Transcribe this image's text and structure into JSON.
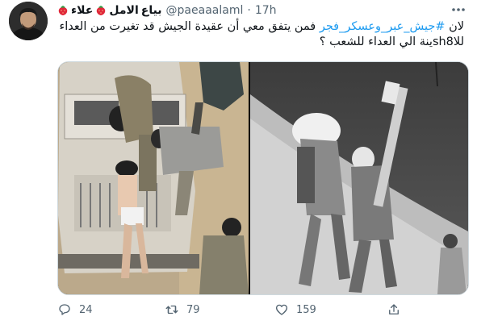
{
  "tweet": {
    "display_name_words": [
      "بياع",
      "الامل",
      "علاء"
    ],
    "handle": "@paeaaalaml",
    "separator": "·",
    "time": "17h",
    "text": {
      "prefix": "لان ",
      "hashtag": "#جيش_عبر_وعسكر_فجر",
      "suffix": " فمن يتفق معي أن عقيدة الجيش قد تغيرت من العداء للاsh8ينة الي العداء للشعب ؟"
    },
    "media": {
      "left_photo": "soldiers-arresting-man-photo",
      "right_photo": "soldiers-crossing-canal-photo"
    },
    "actions": {
      "reply_count": "24",
      "retweet_count": "79",
      "like_count": "159"
    }
  },
  "icons": {
    "more": "more-dots-icon",
    "reply": "reply-bubble-icon",
    "retweet": "retweet-icon",
    "like": "heart-icon",
    "share": "share-icon",
    "strawberry": "strawberry-emoji"
  },
  "colors": {
    "link": "#1d9bf0",
    "secondary_text": "#536471",
    "primary_text": "#0f1419",
    "strawberry": "#e0283a"
  }
}
